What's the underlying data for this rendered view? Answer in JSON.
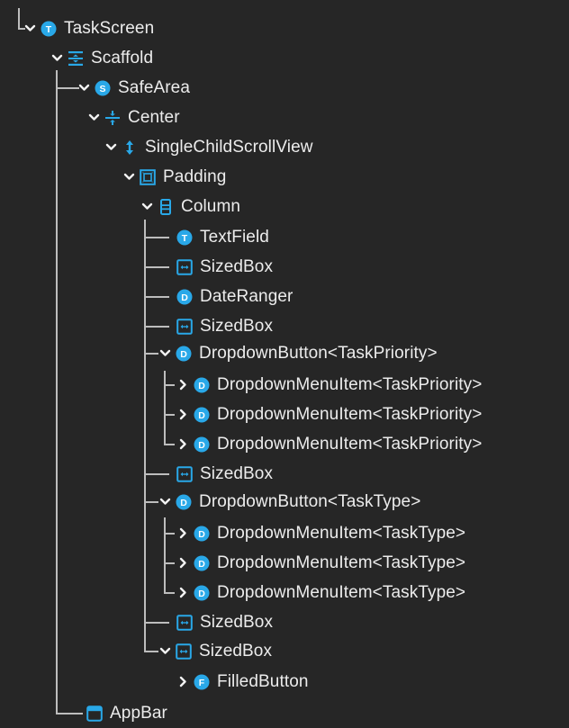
{
  "tree": {
    "nodes": [
      {
        "label": "TaskScreen",
        "icon": "circle-letter-icon",
        "letter": "T",
        "expanded": true
      },
      {
        "label": "Scaffold",
        "icon": "scaffold-icon",
        "expanded": true
      },
      {
        "label": "SafeArea",
        "icon": "circle-letter-icon",
        "letter": "S",
        "expanded": true
      },
      {
        "label": "Center",
        "icon": "center-icon",
        "expanded": true
      },
      {
        "label": "SingleChildScrollView",
        "icon": "vertical-scroll-icon",
        "expanded": true
      },
      {
        "label": "Padding",
        "icon": "padding-icon",
        "expanded": true
      },
      {
        "label": "Column",
        "icon": "column-icon",
        "expanded": true
      },
      {
        "label": "TextField",
        "icon": "circle-letter-icon",
        "letter": "T"
      },
      {
        "label": "SizedBox",
        "icon": "sizedbox-icon"
      },
      {
        "label": "DateRanger",
        "icon": "circle-letter-icon",
        "letter": "D"
      },
      {
        "label": "SizedBox",
        "icon": "sizedbox-icon"
      },
      {
        "label": "DropdownButton<TaskPriority>",
        "icon": "circle-letter-icon",
        "letter": "D",
        "expanded": true
      },
      {
        "label": "DropdownMenuItem<TaskPriority>",
        "icon": "circle-letter-icon",
        "letter": "D",
        "expanded": false
      },
      {
        "label": "DropdownMenuItem<TaskPriority>",
        "icon": "circle-letter-icon",
        "letter": "D",
        "expanded": false
      },
      {
        "label": "DropdownMenuItem<TaskPriority>",
        "icon": "circle-letter-icon",
        "letter": "D",
        "expanded": false
      },
      {
        "label": "SizedBox",
        "icon": "sizedbox-icon"
      },
      {
        "label": "DropdownButton<TaskType>",
        "icon": "circle-letter-icon",
        "letter": "D",
        "expanded": true
      },
      {
        "label": "DropdownMenuItem<TaskType>",
        "icon": "circle-letter-icon",
        "letter": "D",
        "expanded": false
      },
      {
        "label": "DropdownMenuItem<TaskType>",
        "icon": "circle-letter-icon",
        "letter": "D",
        "expanded": false
      },
      {
        "label": "DropdownMenuItem<TaskType>",
        "icon": "circle-letter-icon",
        "letter": "D",
        "expanded": false
      },
      {
        "label": "SizedBox",
        "icon": "sizedbox-icon"
      },
      {
        "label": "SizedBox",
        "icon": "sizedbox-icon",
        "expanded": true
      },
      {
        "label": "FilledButton",
        "icon": "circle-letter-icon",
        "letter": "F",
        "expanded": false
      },
      {
        "label": "AppBar",
        "icon": "appbar-icon"
      }
    ]
  },
  "colors": {
    "background": "#262626",
    "text": "#ececec",
    "icon_blue": "#29a8e8",
    "guide_line": "#bdbdbd"
  }
}
